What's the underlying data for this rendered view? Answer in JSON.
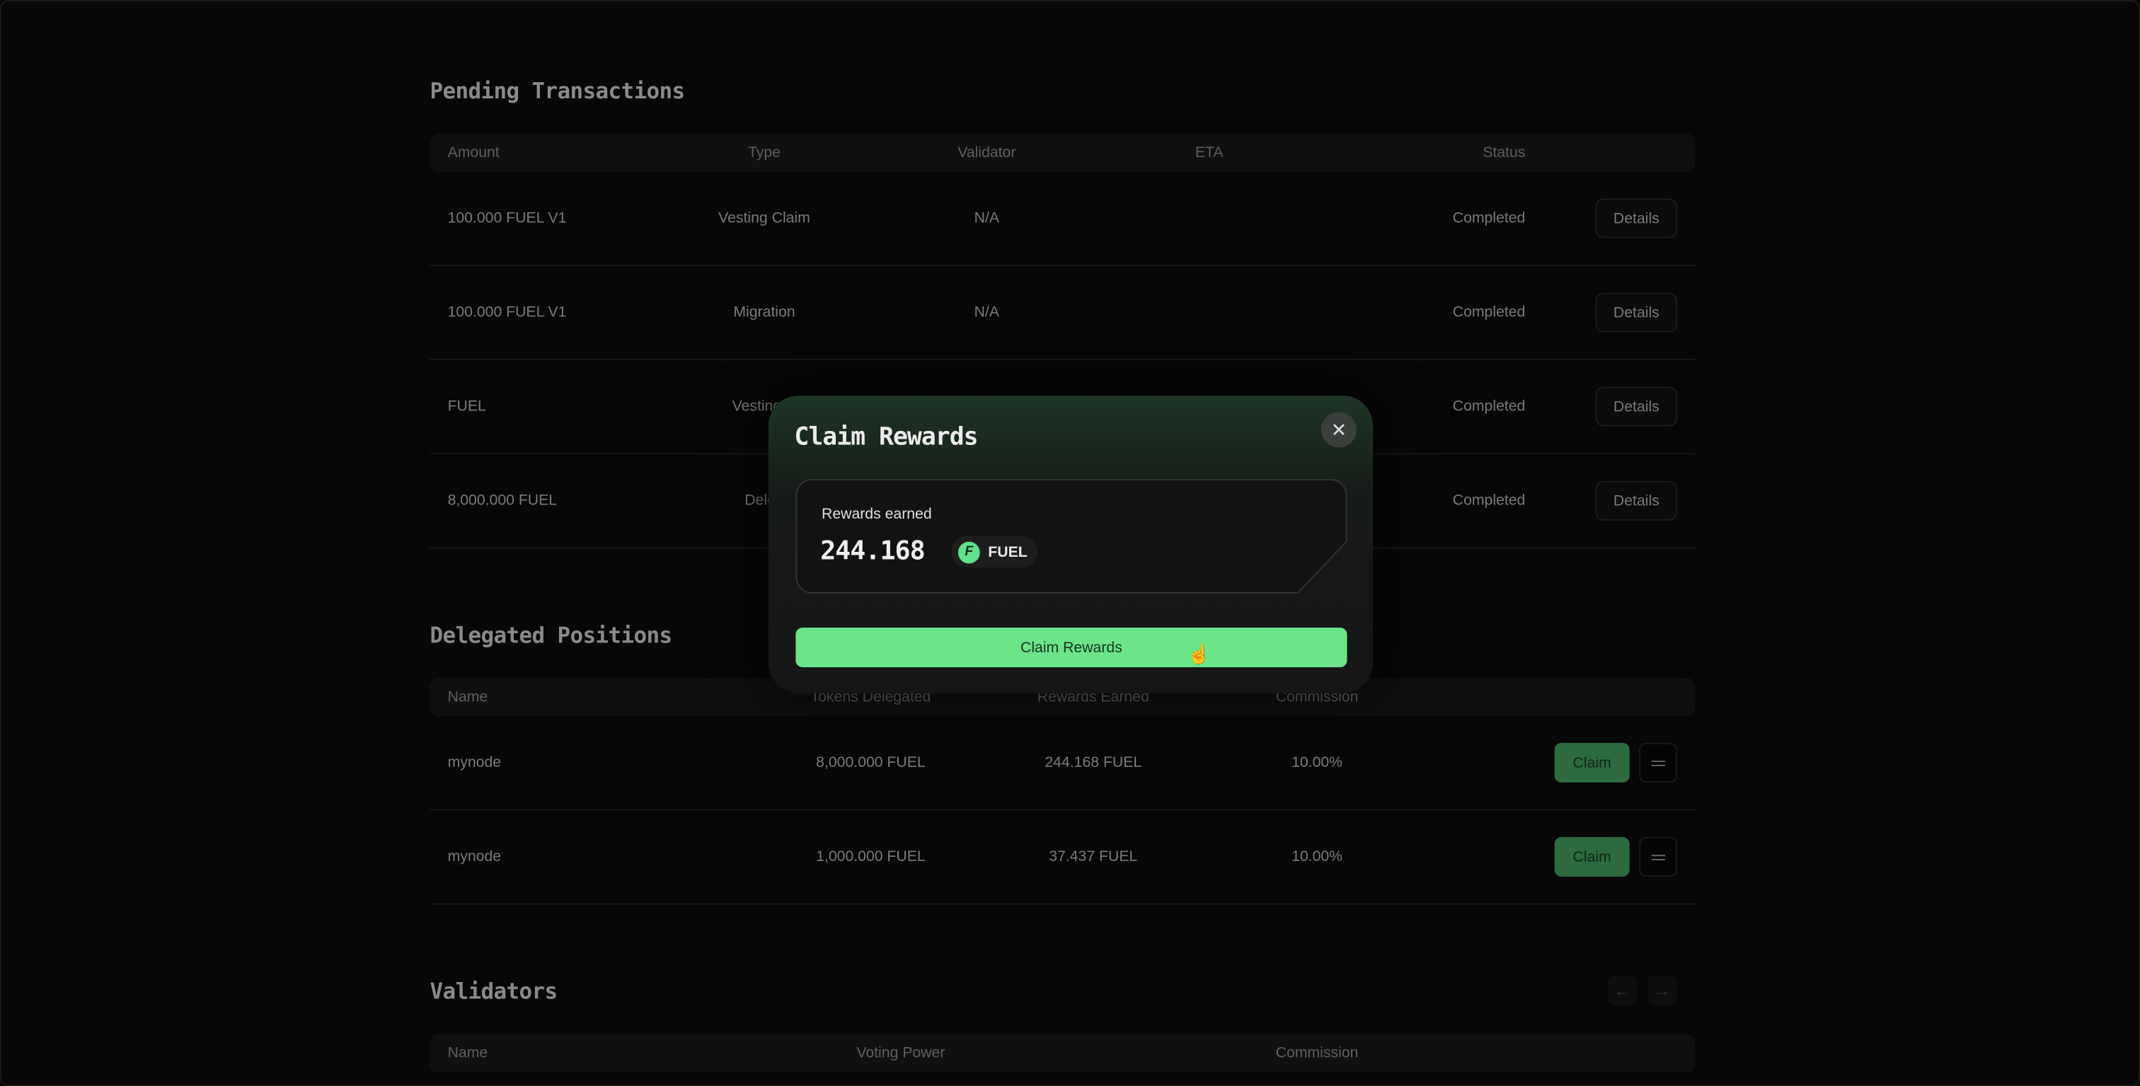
{
  "pending": {
    "title": "Pending Transactions",
    "columns": [
      "Amount",
      "Type",
      "Validator",
      "ETA",
      "Status"
    ],
    "rows": [
      {
        "amount": "100.000 FUEL V1",
        "type": "Vesting Claim",
        "validator": "N/A",
        "eta": "",
        "status": "Completed",
        "action": "Details"
      },
      {
        "amount": "100.000 FUEL V1",
        "type": "Migration",
        "validator": "N/A",
        "eta": "",
        "status": "Completed",
        "action": "Details"
      },
      {
        "amount": "FUEL",
        "type": "Vesting C",
        "validator": "",
        "eta": "",
        "status": "Completed",
        "action": "Details"
      },
      {
        "amount": "8,000.000 FUEL",
        "type": "Deleg",
        "validator": "",
        "eta": "",
        "status": "Completed",
        "action": "Details"
      }
    ]
  },
  "delegated": {
    "title": "Delegated Positions",
    "columns": [
      "Name",
      "Tokens Delegated",
      "Rewards Earned",
      "Commission"
    ],
    "rows": [
      {
        "name": "mynode",
        "tokens": "8,000.000 FUEL",
        "rewards": "244.168 FUEL",
        "commission": "10.00%",
        "action": "Claim"
      },
      {
        "name": "mynode",
        "tokens": "1,000.000 FUEL",
        "rewards": "37.437 FUEL",
        "commission": "10.00%",
        "action": "Claim"
      }
    ]
  },
  "validators": {
    "title": "Validators",
    "columns": [
      "Name",
      "Voting Power",
      "Commission"
    ],
    "prev_icon": "arrow-left-icon",
    "next_icon": "arrow-right-icon"
  },
  "modal": {
    "title": "Claim Rewards",
    "close_icon": "close-icon",
    "rewards_label": "Rewards earned",
    "rewards_value": "244.168",
    "token_symbol": "FUEL",
    "claim_button": "Claim Rewards",
    "accent": "#6be48a"
  }
}
